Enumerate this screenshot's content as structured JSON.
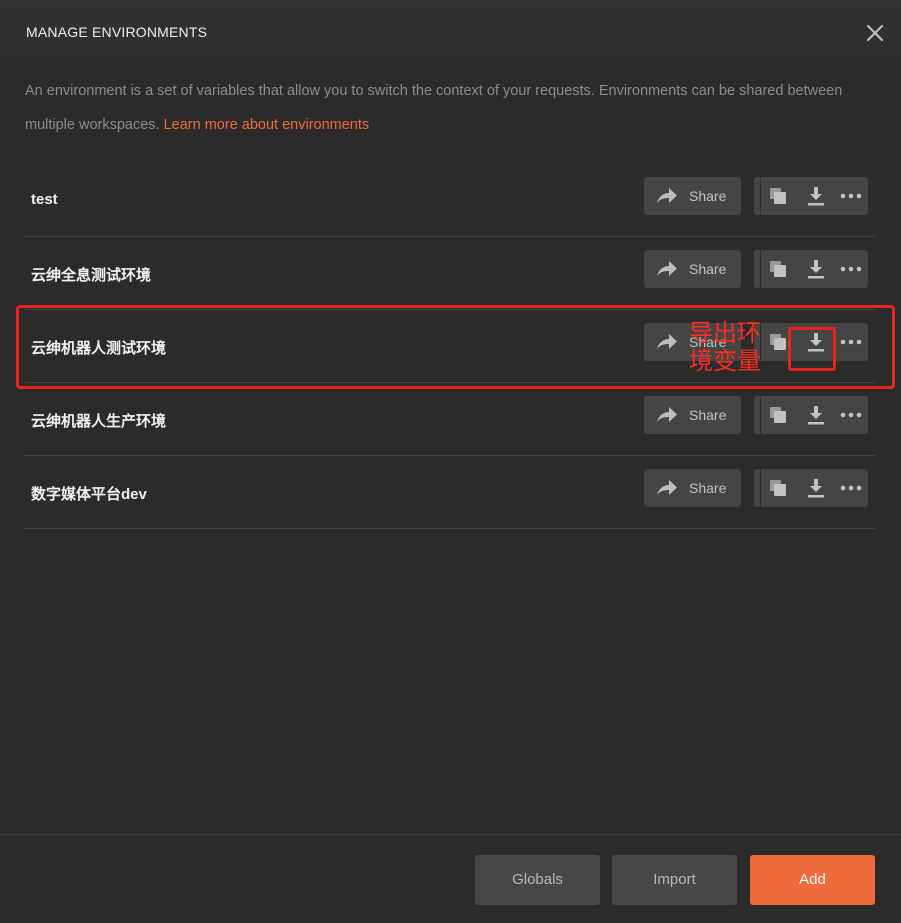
{
  "dialog": {
    "title": "MANAGE ENVIRONMENTS",
    "description": "An environment is a set of variables that allow you to switch the context of your requests. Environments can be shared between multiple workspaces.",
    "learn_more_link": "Learn more about environments"
  },
  "environments": [
    {
      "name": "test",
      "share_label": "Share"
    },
    {
      "name": "云绅全息测试环境",
      "share_label": "Share"
    },
    {
      "name": "云绅机器人测试环境",
      "share_label": "Share"
    },
    {
      "name": "云绅机器人生产环境",
      "share_label": "Share"
    },
    {
      "name": "数字媒体平台dev",
      "share_label": "Share"
    }
  ],
  "annotation": {
    "text": "导出环境变量",
    "color": "#e8241e"
  },
  "footer": {
    "globals_label": "Globals",
    "import_label": "Import",
    "add_label": "Add"
  },
  "icons": {
    "share": "share-arrow-icon",
    "duplicate": "duplicate-icon",
    "download": "download-icon",
    "more": "more-dots-icon",
    "close": "close-icon"
  },
  "colors": {
    "accent": "#ef6b3c",
    "link": "#f26b3a",
    "background": "#2b2b2b",
    "button": "#454545"
  }
}
